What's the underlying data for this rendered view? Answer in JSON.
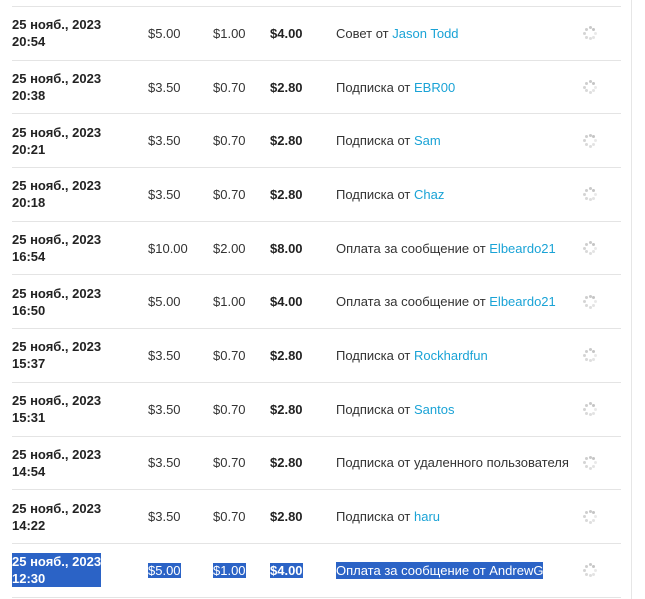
{
  "rows": [
    {
      "date": "25 нояб., 2023",
      "time": "20:54",
      "amount": "$5.00",
      "fee": "$1.00",
      "net": "$4.00",
      "desc_prefix": "Совет от ",
      "user": "Jason Todd",
      "selected": false
    },
    {
      "date": "25 нояб., 2023",
      "time": "20:38",
      "amount": "$3.50",
      "fee": "$0.70",
      "net": "$2.80",
      "desc_prefix": "Подписка от ",
      "user": "EBR00",
      "selected": false
    },
    {
      "date": "25 нояб., 2023",
      "time": "20:21",
      "amount": "$3.50",
      "fee": "$0.70",
      "net": "$2.80",
      "desc_prefix": "Подписка от ",
      "user": "Sam",
      "selected": false
    },
    {
      "date": "25 нояб., 2023",
      "time": "20:18",
      "amount": "$3.50",
      "fee": "$0.70",
      "net": "$2.80",
      "desc_prefix": "Подписка от ",
      "user": "Chaz",
      "selected": false
    },
    {
      "date": "25 нояб., 2023",
      "time": "16:54",
      "amount": "$10.00",
      "fee": "$2.00",
      "net": "$8.00",
      "desc_prefix": "Оплата за сообщение от ",
      "user": "Elbeardo21",
      "selected": false
    },
    {
      "date": "25 нояб., 2023",
      "time": "16:50",
      "amount": "$5.00",
      "fee": "$1.00",
      "net": "$4.00",
      "desc_prefix": "Оплата за сообщение от ",
      "user": "Elbeardo21",
      "selected": false
    },
    {
      "date": "25 нояб., 2023",
      "time": "15:37",
      "amount": "$3.50",
      "fee": "$0.70",
      "net": "$2.80",
      "desc_prefix": "Подписка от ",
      "user": "Rockhardfun",
      "selected": false
    },
    {
      "date": "25 нояб., 2023",
      "time": "15:31",
      "amount": "$3.50",
      "fee": "$0.70",
      "net": "$2.80",
      "desc_prefix": "Подписка от ",
      "user": "Santos",
      "selected": false
    },
    {
      "date": "25 нояб., 2023",
      "time": "14:54",
      "amount": "$3.50",
      "fee": "$0.70",
      "net": "$2.80",
      "desc_prefix": "Подписка от удаленного пользователя",
      "user": "",
      "selected": false
    },
    {
      "date": "25 нояб., 2023",
      "time": "14:22",
      "amount": "$3.50",
      "fee": "$0.70",
      "net": "$2.80",
      "desc_prefix": "Подписка от ",
      "user": "haru",
      "selected": false
    },
    {
      "date": "25 нояб., 2023",
      "time": "12:30",
      "amount": "$5.00",
      "fee": "$1.00",
      "net": "$4.00",
      "desc_prefix": "Оплата за сообщение от ",
      "user": "AndrewG",
      "selected": true
    }
  ],
  "status_icon": "loading-spinner-icon",
  "colors": {
    "link": "#1aa3d6",
    "selection": "#2b63c6",
    "border": "#e4e4e4"
  }
}
